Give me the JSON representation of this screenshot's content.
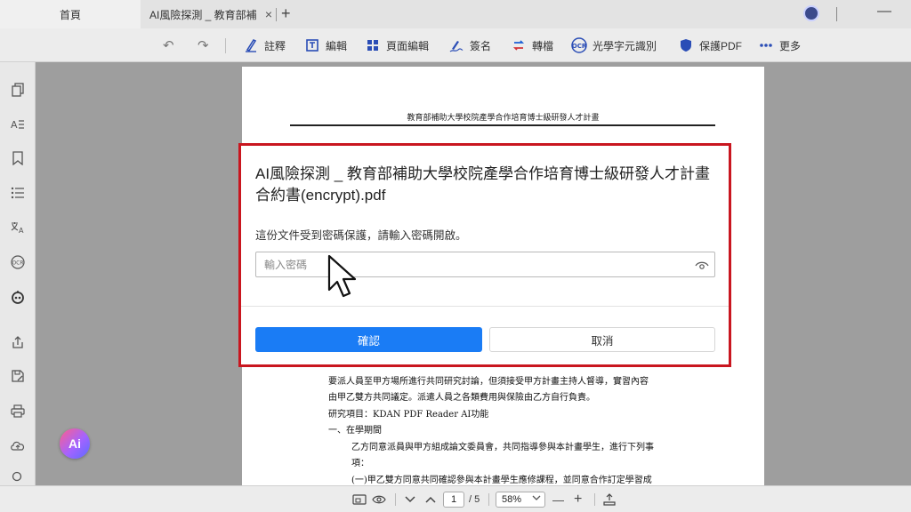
{
  "tabs": {
    "home_label": "首頁",
    "doc_label": "AI風險探測 _ 教育部補助...",
    "close_glyph": "×",
    "new_tab_glyph": "+"
  },
  "window": {
    "minimize_glyph": "—"
  },
  "toolbar": {
    "undo_glyph": "↶",
    "redo_glyph": "↷",
    "items": [
      {
        "label": "註釋",
        "icon": "pen-icon"
      },
      {
        "label": "編輯",
        "icon": "edit-icon"
      },
      {
        "label": "頁面編輯",
        "icon": "page-grid-icon"
      },
      {
        "label": "簽名",
        "icon": "signature-icon"
      },
      {
        "label": "轉檔",
        "icon": "convert-icon"
      },
      {
        "label": "光學字元識別",
        "icon": "ocr-icon"
      },
      {
        "label": "保護PDF",
        "icon": "shield-icon"
      },
      {
        "label": "更多",
        "icon": "more-icon"
      }
    ]
  },
  "document": {
    "header": "教育部補助大學校院產學合作培育博士級研發人才計畫",
    "lines": [
      "要派人員至甲方場所進行共同研究討論，但須接受甲方計畫主持人督導，實習內容",
      "由甲乙雙方共同議定。派遣人員之各類費用與保險由乙方自行負責。",
      "研究項目：KDAN PDF Reader AI功能",
      "一、在學期間",
      "乙方同意派員與甲方組成論文委員會，共同指導參與本計畫學生，進行下列事",
      "項：",
      "(一)甲乙雙方同意共同確認參與本計畫學生應修課程，並同意合作訂定學習成"
    ]
  },
  "dialog": {
    "title": "AI風險探測 _ 教育部補助大學校院產學合作培育博士級研發人才計畫合約書(encrypt).pdf",
    "message": "這份文件受到密碼保護，請輸入密碼開啟。",
    "input_placeholder": "輸入密碼",
    "input_value": "",
    "confirm_label": "確認",
    "cancel_label": "取消"
  },
  "ai_button": {
    "label": "Ai"
  },
  "bottombar": {
    "current_page": "1",
    "total_pages": "/ 5",
    "zoom": "58%",
    "zoom_out_glyph": "—",
    "zoom_in_glyph": "+"
  },
  "colors": {
    "accent": "#1a7cf5",
    "highlight_border": "#c9161f",
    "toolbar_icon": "#2a4db6"
  }
}
